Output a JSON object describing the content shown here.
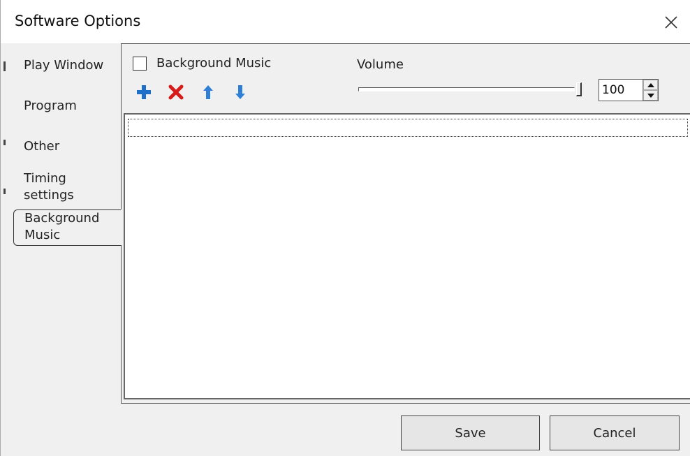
{
  "window": {
    "title": "Software Options"
  },
  "tabs": [
    {
      "label": "Play Window",
      "active": false
    },
    {
      "label": "Program",
      "active": false
    },
    {
      "label": "Other",
      "active": false
    },
    {
      "line1": "Timing",
      "line2": "settings",
      "active": false
    },
    {
      "line1": "Background",
      "line2": "Music",
      "active": true
    }
  ],
  "background_music": {
    "checkbox_label": "Background Music",
    "checked": false,
    "toolbar_icons": [
      "add-icon",
      "delete-icon",
      "move-up-icon",
      "move-down-icon"
    ],
    "volume_label": "Volume",
    "volume_value": "100",
    "volume_fraction": 1.0,
    "playlist_items": []
  },
  "buttons": {
    "save": "Save",
    "cancel": "Cancel"
  },
  "colors": {
    "add": "#1e6fc8",
    "delete": "#d61b1b",
    "arrow": "#2f7fd6"
  }
}
